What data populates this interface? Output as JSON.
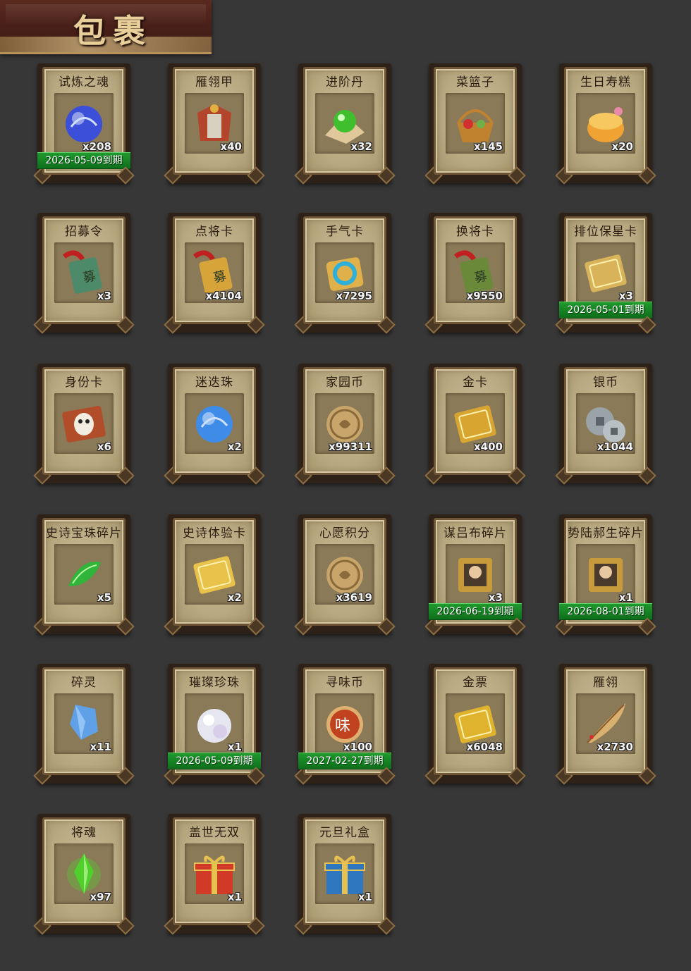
{
  "window": {
    "title": "包裹"
  },
  "inventory": {
    "items": [
      {
        "name": "试炼之魂",
        "qty": "x208",
        "expiry": "2026-05-09到期",
        "icon": "blue-dragon-orb-icon",
        "color": "#3b4fd8"
      },
      {
        "name": "雁翎甲",
        "qty": "x40",
        "expiry": "",
        "icon": "armor-icon",
        "color": "#b2452c"
      },
      {
        "name": "进阶丹",
        "qty": "x32",
        "expiry": "",
        "icon": "green-pill-icon",
        "color": "#3fbf2e"
      },
      {
        "name": "菜篮子",
        "qty": "x145",
        "expiry": "",
        "icon": "basket-icon",
        "color": "#c0822f"
      },
      {
        "name": "生日寿糕",
        "qty": "x20",
        "expiry": "",
        "icon": "cake-icon",
        "color": "#f0a233"
      },
      {
        "name": "招募令",
        "qty": "x3",
        "expiry": "",
        "icon": "recruit-token-icon",
        "color": "#4c8a6a"
      },
      {
        "name": "点将卡",
        "qty": "x4104",
        "expiry": "",
        "icon": "general-card-icon",
        "color": "#d7a43a"
      },
      {
        "name": "手气卡",
        "qty": "x7295",
        "expiry": "",
        "icon": "luck-card-icon",
        "color": "#2fb0d8"
      },
      {
        "name": "换将卡",
        "qty": "x9550",
        "expiry": "",
        "icon": "swap-general-card-icon",
        "color": "#6a8a3a"
      },
      {
        "name": "排位保星卡",
        "qty": "x3",
        "expiry": "2026-05-01到期",
        "icon": "rank-star-card-icon",
        "color": "#d8b35a"
      },
      {
        "name": "身份卡",
        "qty": "x6",
        "expiry": "",
        "icon": "identity-mask-card-icon",
        "color": "#b24d2a"
      },
      {
        "name": "迷迭珠",
        "qty": "x2",
        "expiry": "",
        "icon": "blue-pearl-icon",
        "color": "#3f8be8"
      },
      {
        "name": "家园币",
        "qty": "x99311",
        "expiry": "",
        "icon": "home-coin-icon",
        "color": "#c8a56a"
      },
      {
        "name": "金卡",
        "qty": "x400",
        "expiry": "",
        "icon": "gold-card-icon",
        "color": "#d9a531"
      },
      {
        "name": "银币",
        "qty": "x1044",
        "expiry": "",
        "icon": "silver-coin-icon",
        "color": "#9aa3a8"
      },
      {
        "name": "史诗宝珠碎片",
        "qty": "x5",
        "expiry": "",
        "icon": "green-shard-icon",
        "color": "#2fb53a"
      },
      {
        "name": "史诗体验卡",
        "qty": "x2",
        "expiry": "",
        "icon": "epic-trial-card-icon",
        "color": "#e8c24a"
      },
      {
        "name": "心愿积分",
        "qty": "x3619",
        "expiry": "",
        "icon": "wish-coin-icon",
        "color": "#c8a56a"
      },
      {
        "name": "谋吕布碎片",
        "qty": "x3",
        "expiry": "2026-06-19到期",
        "icon": "puzzle-portrait-icon",
        "color": "#c79a3c"
      },
      {
        "name": "势陆郝生碎片",
        "qty": "x1",
        "expiry": "2026-08-01到期",
        "icon": "puzzle-portrait-icon",
        "color": "#c79a3c"
      },
      {
        "name": "碎灵",
        "qty": "x11",
        "expiry": "",
        "icon": "crystal-shard-icon",
        "color": "#5fa0e6"
      },
      {
        "name": "璀璨珍珠",
        "qty": "x1",
        "expiry": "2026-05-09到期",
        "icon": "white-pearl-icon",
        "color": "#e6e6f0"
      },
      {
        "name": "寻味币",
        "qty": "x100",
        "expiry": "2027-02-27到期",
        "icon": "flavor-coin-icon",
        "color": "#c0421f"
      },
      {
        "name": "金票",
        "qty": "x6048",
        "expiry": "",
        "icon": "gold-ticket-icon",
        "color": "#e0b32e"
      },
      {
        "name": "雁翎",
        "qty": "x2730",
        "expiry": "",
        "icon": "feather-icon",
        "color": "#d8b070"
      },
      {
        "name": "将魂",
        "qty": "x97",
        "expiry": "",
        "icon": "general-soul-crystal-icon",
        "color": "#4fd02a"
      },
      {
        "name": "盖世无双",
        "qty": "x1",
        "expiry": "",
        "icon": "red-gift-box-icon",
        "color": "#d23a28"
      },
      {
        "name": "元旦礼盒",
        "qty": "x1",
        "expiry": "",
        "icon": "blue-gift-box-icon",
        "color": "#2f78c0"
      }
    ]
  }
}
